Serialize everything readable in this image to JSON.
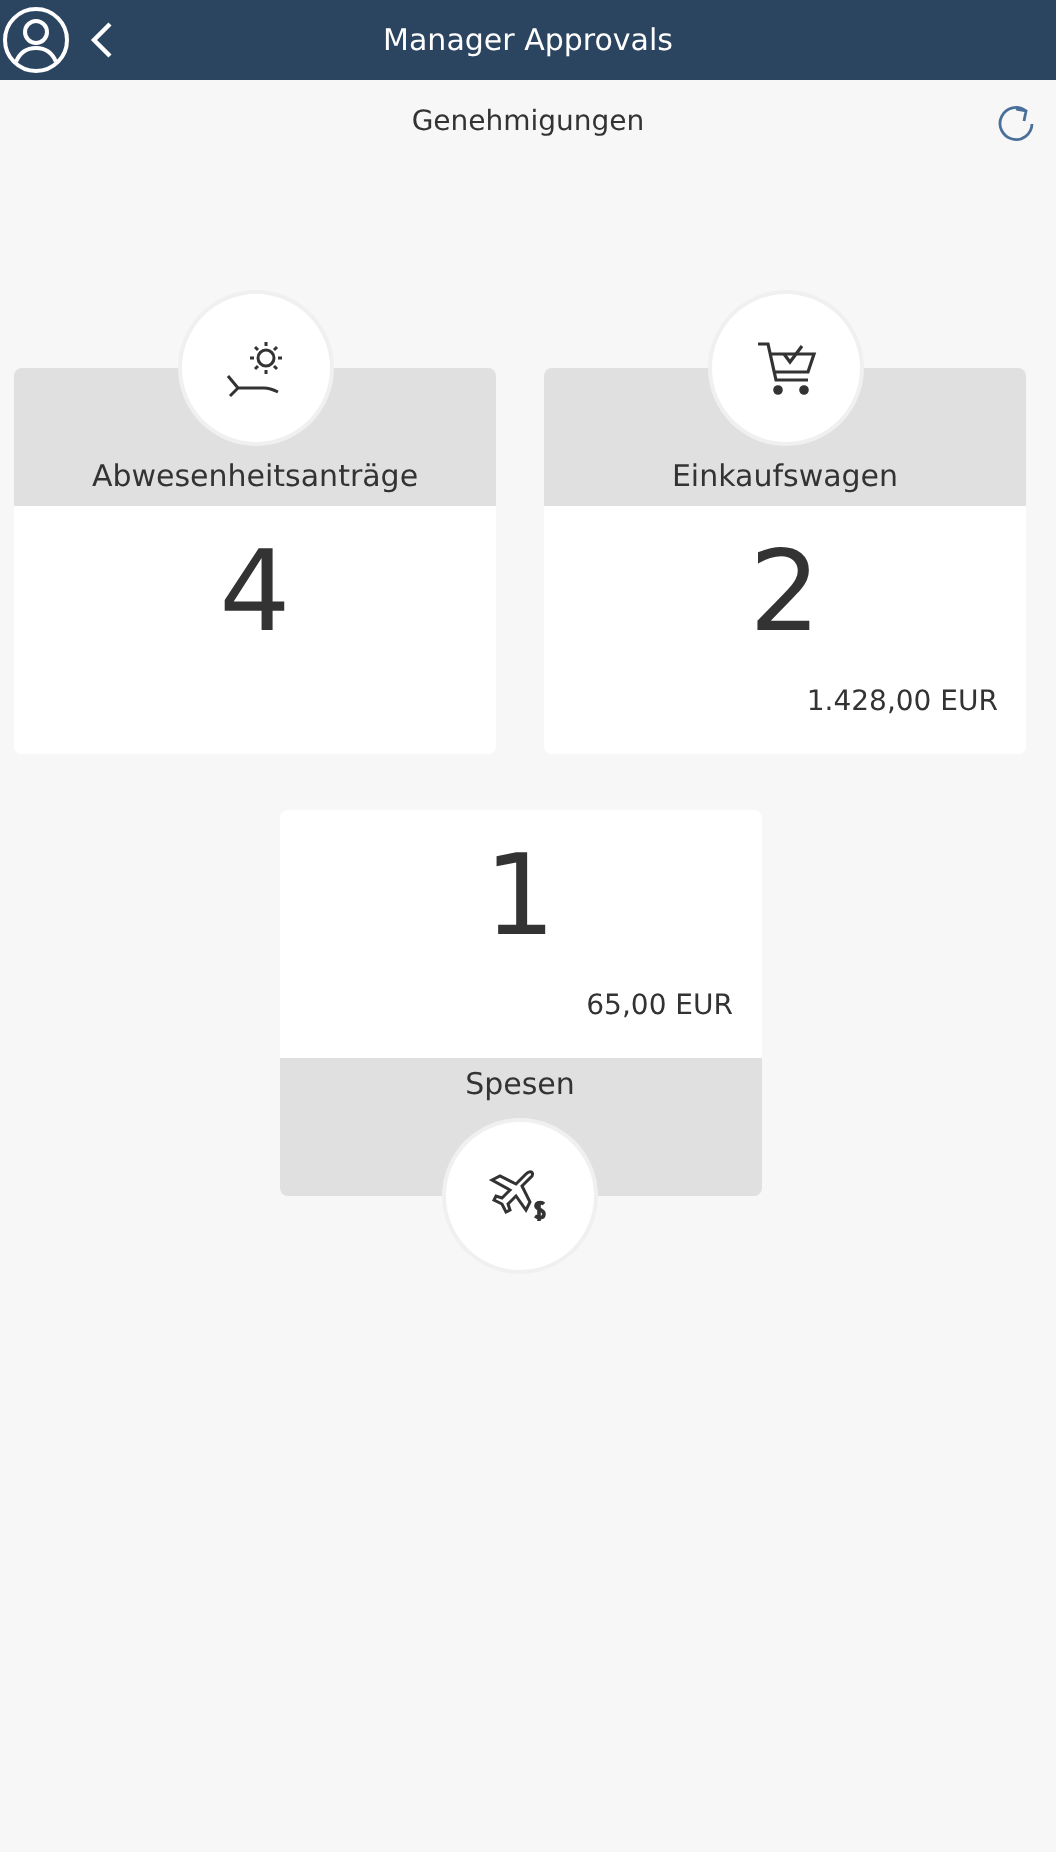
{
  "header": {
    "title": "Manager Approvals"
  },
  "subheader": {
    "title": "Genehmigungen"
  },
  "tiles": [
    {
      "kind": "icon_top",
      "label": "Abwesenheitsanträge",
      "count": "4"
    },
    {
      "kind": "icon_top",
      "label": "Einkaufswagen",
      "count": "2",
      "amount": "1.428,00 EUR"
    },
    {
      "kind": "icon_bottom",
      "label": "Spesen",
      "count": "1",
      "amount": "65,00 EUR"
    }
  ]
}
